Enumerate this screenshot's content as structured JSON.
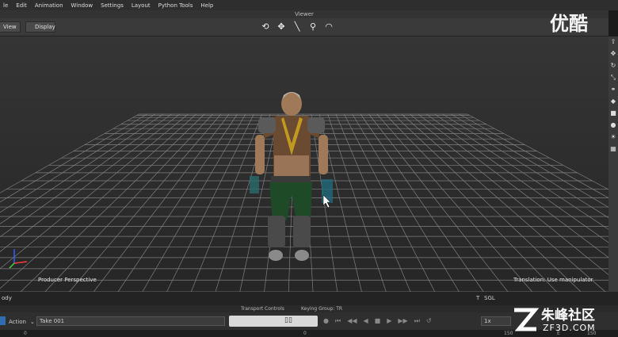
{
  "menu": [
    "le",
    "Edit",
    "Animation",
    "Window",
    "Settings",
    "Layout",
    "Python Tools",
    "Help"
  ],
  "viewer_title": "Viewer",
  "toolbar": {
    "view_label": "View",
    "display_label": "Display"
  },
  "viewport": {
    "camera_label": "Producer Perspective",
    "hint": "Translation: Use manipulator"
  },
  "status": {
    "left_text": "ody",
    "transport_title": "Transport Controls",
    "keying_group": "Keying Group: TR",
    "t_label": "T",
    "t_value": "SGL"
  },
  "transport": {
    "mode": "Action",
    "take": "Take 001",
    "speed": "1x"
  },
  "timeline": {
    "start": "0",
    "mark": "0",
    "end_mark": "150",
    "e_label": "E",
    "end": "150"
  },
  "watermark": "优酷",
  "brand": {
    "name": "朱峰社区",
    "url": "ZF3D.COM"
  },
  "rightbar_icons": [
    "cursor-icon",
    "move-icon",
    "rotate-icon",
    "scale-icon",
    "link-icon",
    "bone-icon",
    "cube-icon",
    "sphere-icon",
    "light-icon",
    "grid-icon"
  ]
}
